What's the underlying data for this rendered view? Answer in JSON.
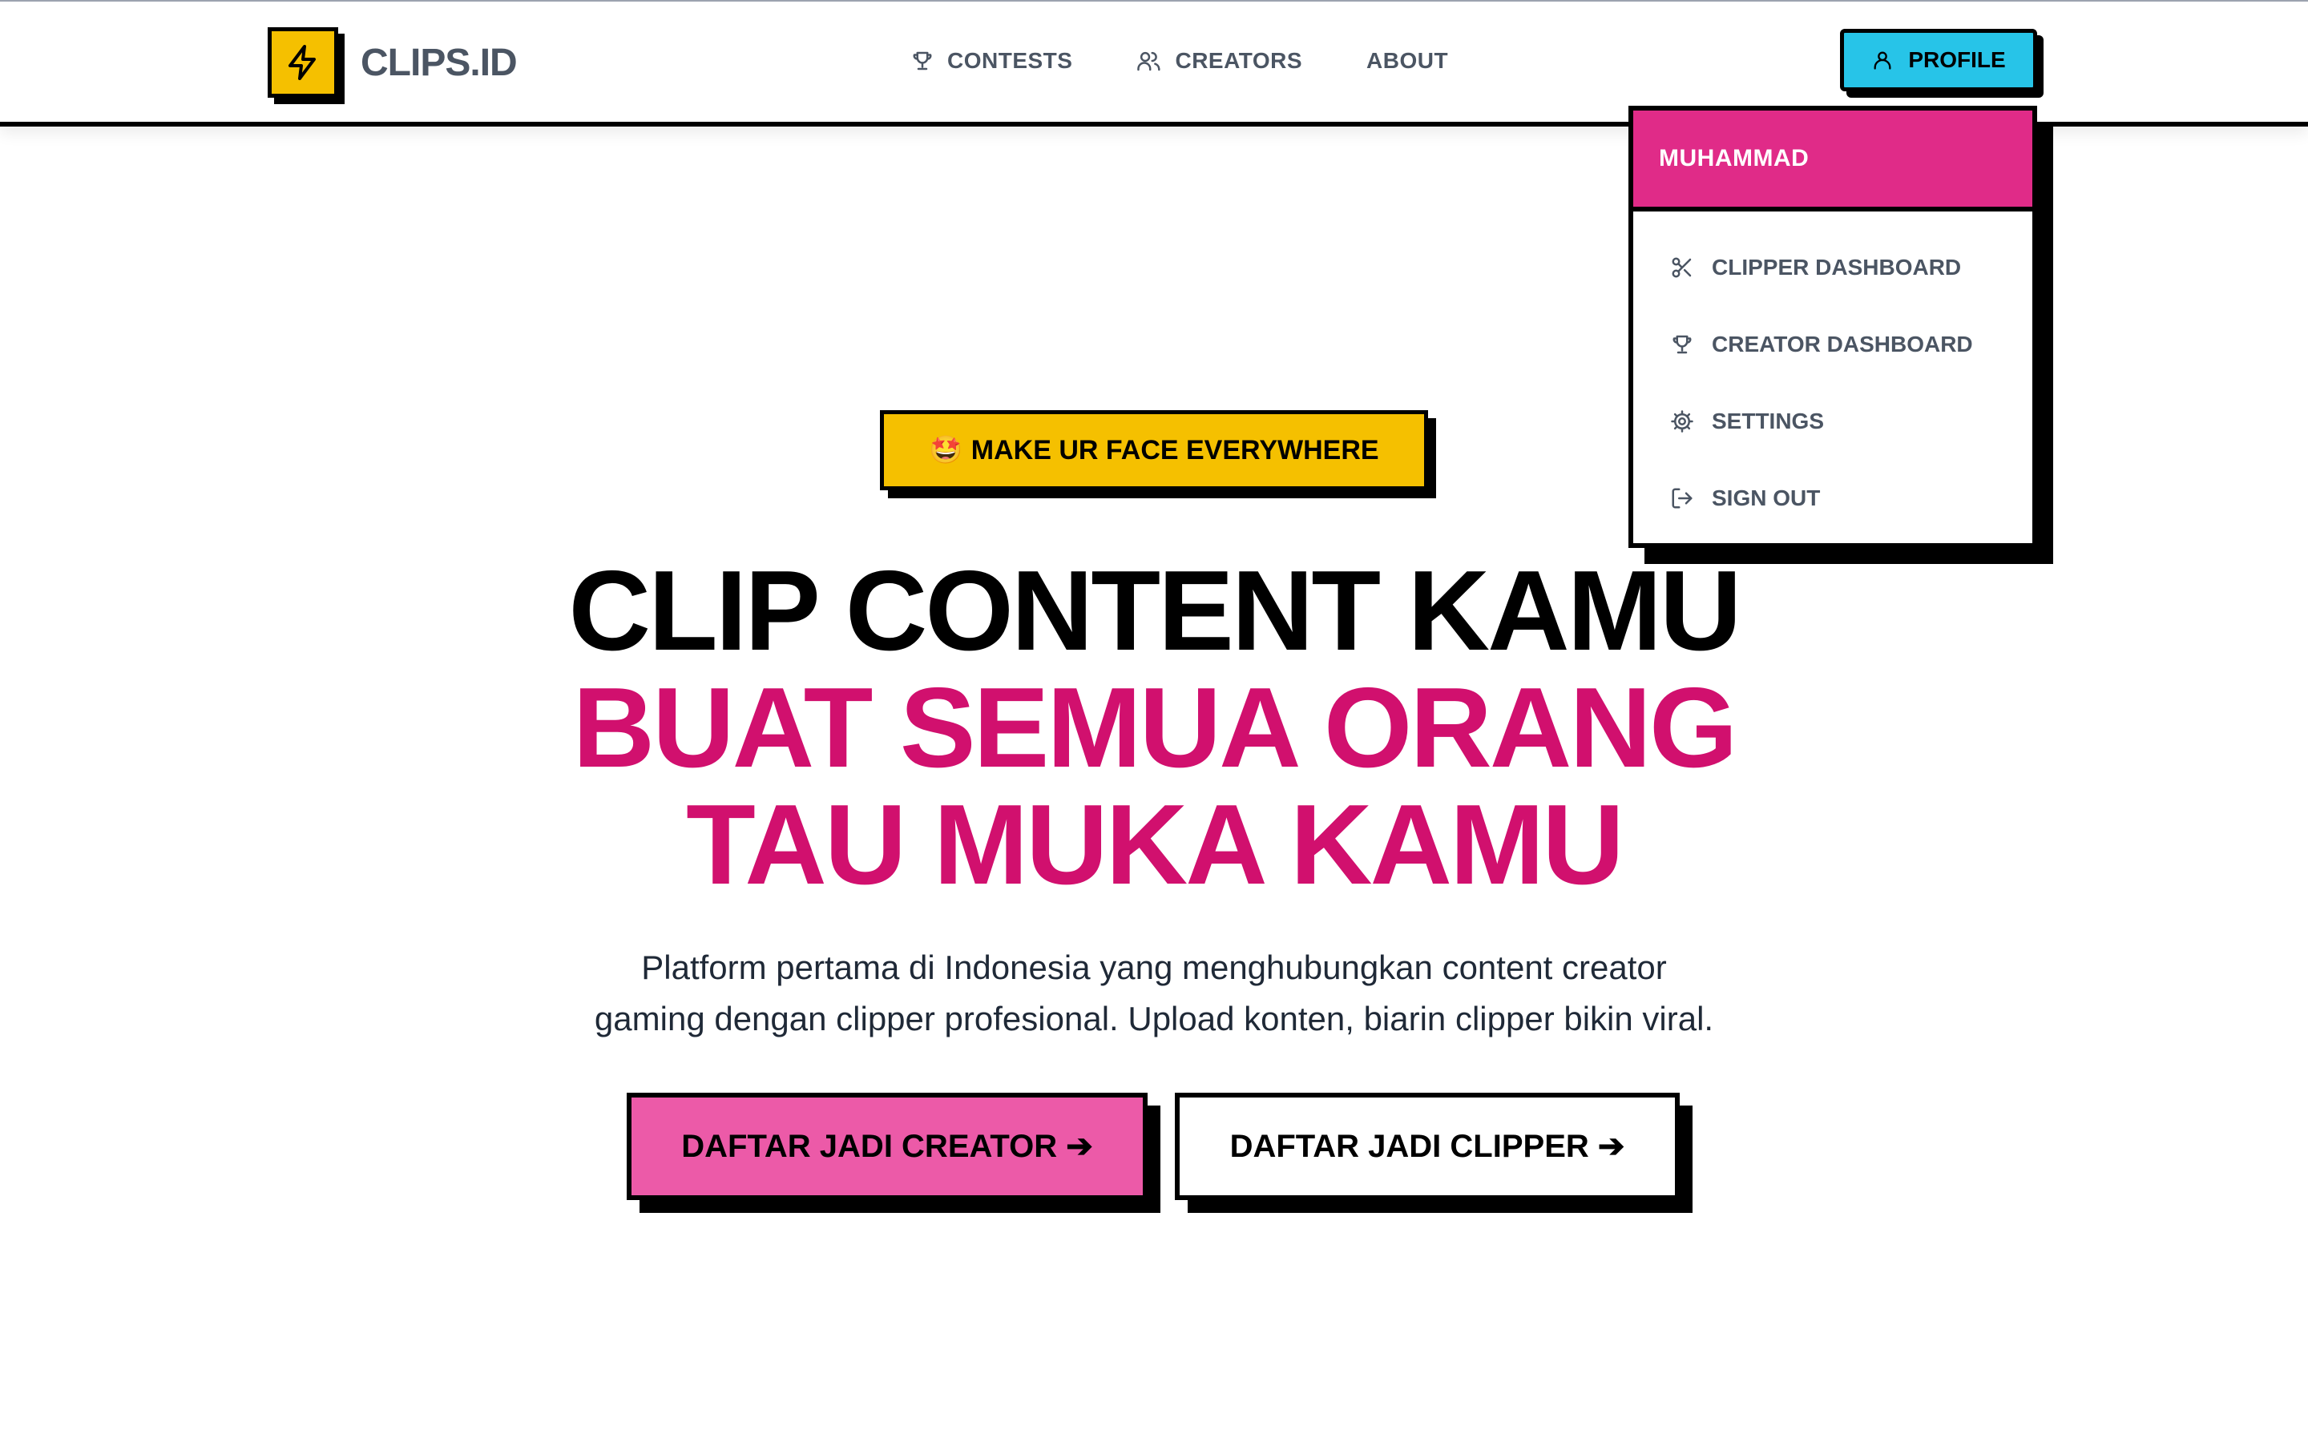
{
  "brand": {
    "name": "CLIPS.ID",
    "icon": "lightning-icon",
    "accent": "#f5c000"
  },
  "nav": {
    "links": [
      {
        "label": "CONTESTS",
        "icon": "trophy-icon"
      },
      {
        "label": "CREATORS",
        "icon": "users-icon"
      },
      {
        "label": "ABOUT"
      }
    ],
    "profile_label": "PROFILE",
    "profile_color": "#27c4e8"
  },
  "dropdown": {
    "user_name": "MUHAMMAD",
    "header_color": "#e02b88",
    "items": [
      {
        "label": "CLIPPER DASHBOARD",
        "icon": "scissors-icon"
      },
      {
        "label": "CREATOR DASHBOARD",
        "icon": "trophy-icon"
      },
      {
        "label": "SETTINGS",
        "icon": "gear-icon"
      },
      {
        "label": "SIGN OUT",
        "icon": "sign-out-icon"
      }
    ]
  },
  "hero": {
    "badge_emoji": "🤩",
    "badge_text": "MAKE UR FACE EVERYWHERE",
    "headline_line1": "CLIP CONTENT KAMU",
    "headline_line2": "BUAT SEMUA ORANG",
    "headline_line3": "TAU MUKA KAMU",
    "highlight_color": "#d1106e",
    "subtitle_line1": "Platform pertama di Indonesia yang menghubungkan content creator",
    "subtitle_line2": "gaming dengan clipper profesional. Upload konten, biarin clipper bikin viral.",
    "cta_creator": "DAFTAR JADI CREATOR ➔",
    "cta_clipper": "DAFTAR JADI CLIPPER ➔"
  }
}
